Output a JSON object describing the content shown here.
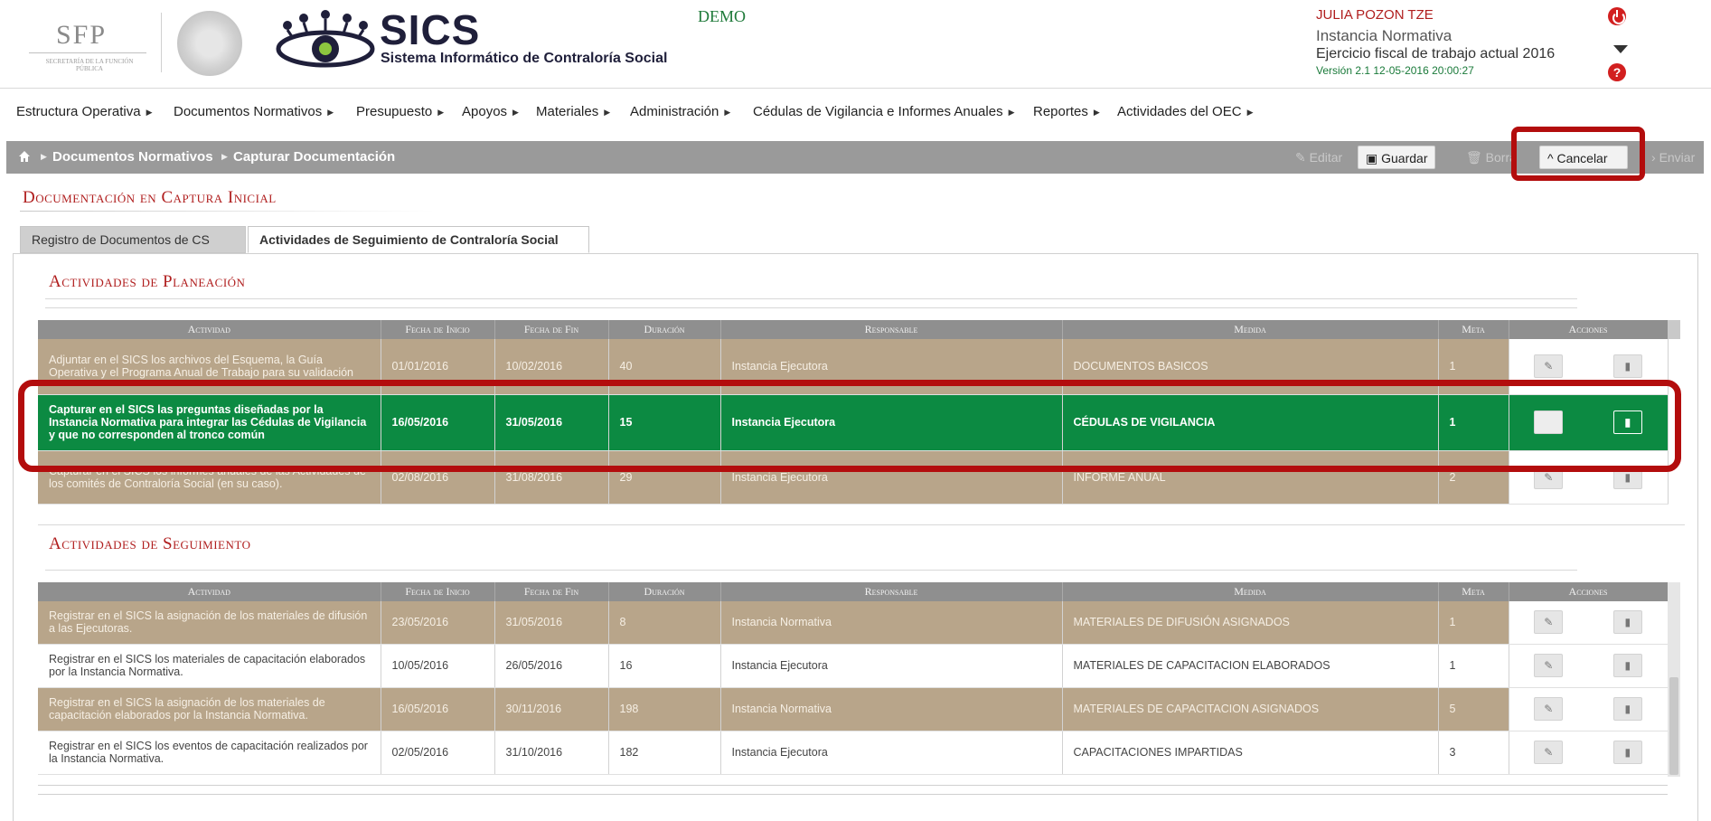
{
  "header": {
    "sfp_title": "SFP",
    "sfp_subtitle": "SECRETARÍA DE LA FUNCIÓN PÚBLICA",
    "app_title": "SICS",
    "app_subtitle": "Sistema Informático de Contraloría Social",
    "environment": "DEMO",
    "user_name": "JULIA POZON TZE",
    "user_role": "Instancia Normativa",
    "ejercicio": "Ejercicio fiscal de trabajo actual  2016",
    "version": "Versión 2.1   12-05-2016 20:00:27"
  },
  "menu": [
    "Estructura Operativa",
    "Documentos Normativos",
    "Presupuesto",
    "Apoyos",
    "Materiales",
    "Administración",
    "Cédulas de Vigilancia e Informes Anuales",
    "Reportes",
    "Actividades del OEC"
  ],
  "breadcrumb": {
    "level1": "Documentos Normativos",
    "level2": "Capturar Documentación"
  },
  "toolbar": {
    "editar": "Editar",
    "guardar": "Guardar",
    "borrar": "Borra",
    "cancelar": "Cancelar",
    "enviar": "Enviar"
  },
  "section_title": "Documentación en Captura Inicial",
  "tabs": [
    "Registro de Documentos de CS",
    "Actividades de Seguimiento de Contraloría Social"
  ],
  "columns": [
    "Actividad",
    "Fecha de Inicio",
    "Fecha de Fin",
    "Duración",
    "Responsable",
    "Medida",
    "Meta",
    "Acciones"
  ],
  "planeacion": {
    "title": "Actividades de Planeación",
    "rows": [
      {
        "actividad": "Adjuntar en el SICS los archivos del Esquema, la Guía Operativa y el Programa Anual de Trabajo para su validación",
        "inicio": "01/01/2016",
        "fin": "10/02/2016",
        "duracion": "40",
        "responsable": "Instancia Ejecutora",
        "medida": "DOCUMENTOS BASICOS",
        "meta": "1"
      },
      {
        "actividad": "Capturar en el SICS las preguntas diseñadas por la Instancia Normativa para integrar las Cédulas de Vigilancia y que no corresponden al tronco común",
        "inicio": "16/05/2016",
        "fin": "31/05/2016",
        "duracion": "15",
        "responsable": "Instancia Ejecutora",
        "medida": "CÉDULAS DE VIGILANCIA",
        "meta": "1"
      },
      {
        "actividad": "Capturar en el SICS los informes anuales de las Actividades de los comités de Contraloría Social (en su caso).",
        "inicio": "02/08/2016",
        "fin": "31/08/2016",
        "duracion": "29",
        "responsable": "Instancia Ejecutora",
        "medida": "INFORME ANUAL",
        "meta": "2"
      }
    ]
  },
  "seguimiento": {
    "title": "Actividades de Seguimiento",
    "rows": [
      {
        "actividad": "Registrar en el SICS la asignación de los materiales de difusión a las Ejecutoras.",
        "inicio": "23/05/2016",
        "fin": "31/05/2016",
        "duracion": "8",
        "responsable": "Instancia Normativa",
        "medida": "MATERIALES DE DIFUSIÓN ASIGNADOS",
        "meta": "1"
      },
      {
        "actividad": "Registrar en el SICS los materiales de capacitación elaborados por la Instancia Normativa.",
        "inicio": "10/05/2016",
        "fin": "26/05/2016",
        "duracion": "16",
        "responsable": "Instancia Ejecutora",
        "medida": "MATERIALES DE CAPACITACION ELABORADOS",
        "meta": "1"
      },
      {
        "actividad": "Registrar en el SICS la asignación de los materiales de capacitación elaborados por la Instancia Normativa.",
        "inicio": "16/05/2016",
        "fin": "30/11/2016",
        "duracion": "198",
        "responsable": "Instancia Normativa",
        "medida": "MATERIALES DE CAPACITACION ASIGNADOS",
        "meta": "5"
      },
      {
        "actividad": "Registrar en el SICS los eventos de capacitación realizados por la Instancia Normativa.",
        "inicio": "02/05/2016",
        "fin": "31/10/2016",
        "duracion": "182",
        "responsable": "Instancia Ejecutora",
        "medida": "CAPACITACIONES IMPARTIDAS",
        "meta": "3"
      }
    ]
  }
}
